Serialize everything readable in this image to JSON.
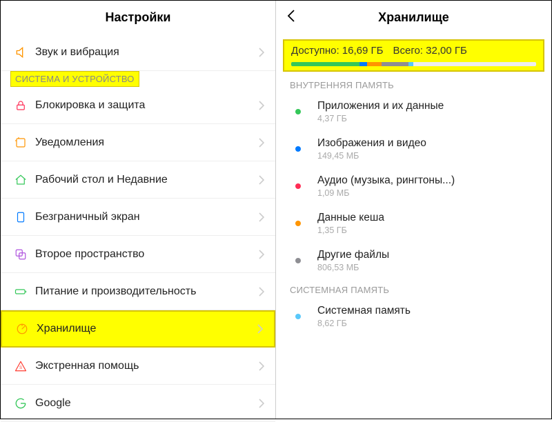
{
  "left": {
    "title": "Настройки",
    "top_row": {
      "label": "Звук и вибрация",
      "icon": "sound-icon",
      "color": "#ff9500"
    },
    "section_label": "СИСТЕМА И УСТРОЙСТВО",
    "rows": [
      {
        "label": "Блокировка и защита",
        "icon": "lock-icon",
        "color": "#ff2d55"
      },
      {
        "label": "Уведомления",
        "icon": "notification-icon",
        "color": "#ff9500"
      },
      {
        "label": "Рабочий стол и Недавние",
        "icon": "home-icon",
        "color": "#34c759"
      },
      {
        "label": "Безграничный экран",
        "icon": "display-icon",
        "color": "#007aff"
      },
      {
        "label": "Второе пространство",
        "icon": "secondspace-icon",
        "color": "#af52de"
      },
      {
        "label": "Питание и производительность",
        "icon": "battery-icon",
        "color": "#34c759"
      },
      {
        "label": "Хранилище",
        "icon": "storage-icon",
        "color": "#ff9500",
        "highlight": true
      },
      {
        "label": "Экстренная помощь",
        "icon": "emergency-icon",
        "color": "#ff3b30"
      },
      {
        "label": "Google",
        "icon": "google-icon",
        "color": "#34c759"
      }
    ]
  },
  "right": {
    "title": "Хранилище",
    "summary": {
      "available_label": "Доступно:",
      "available_value": "16,69 ГБ",
      "total_label": "Всего:",
      "total_value": "32,00 ГБ"
    },
    "bar": [
      {
        "color": "#34c759",
        "width": 28
      },
      {
        "color": "#007aff",
        "width": 3
      },
      {
        "color": "#ff9500",
        "width": 6
      },
      {
        "color": "#8e8e93",
        "width": 11
      },
      {
        "color": "#5ac8fa",
        "width": 2
      }
    ],
    "section_internal": "ВНУТРЕННЯЯ ПАМЯТЬ",
    "items": [
      {
        "title": "Приложения и их данные",
        "sub": "4,37 ГБ",
        "color": "#34c759"
      },
      {
        "title": "Изображения и видео",
        "sub": "149,45 МБ",
        "color": "#007aff"
      },
      {
        "title": "Аудио (музыка, рингтоны...)",
        "sub": "1,09 МБ",
        "color": "#ff2d55"
      },
      {
        "title": "Данные кеша",
        "sub": "1,35 ГБ",
        "color": "#ff9500"
      },
      {
        "title": "Другие файлы",
        "sub": "806,53 МБ",
        "color": "#8e8e93"
      }
    ],
    "section_system": "СИСТЕМНАЯ ПАМЯТЬ",
    "system_item": {
      "title": "Системная память",
      "sub": "8,62 ГБ",
      "color": "#5ac8fa"
    }
  }
}
